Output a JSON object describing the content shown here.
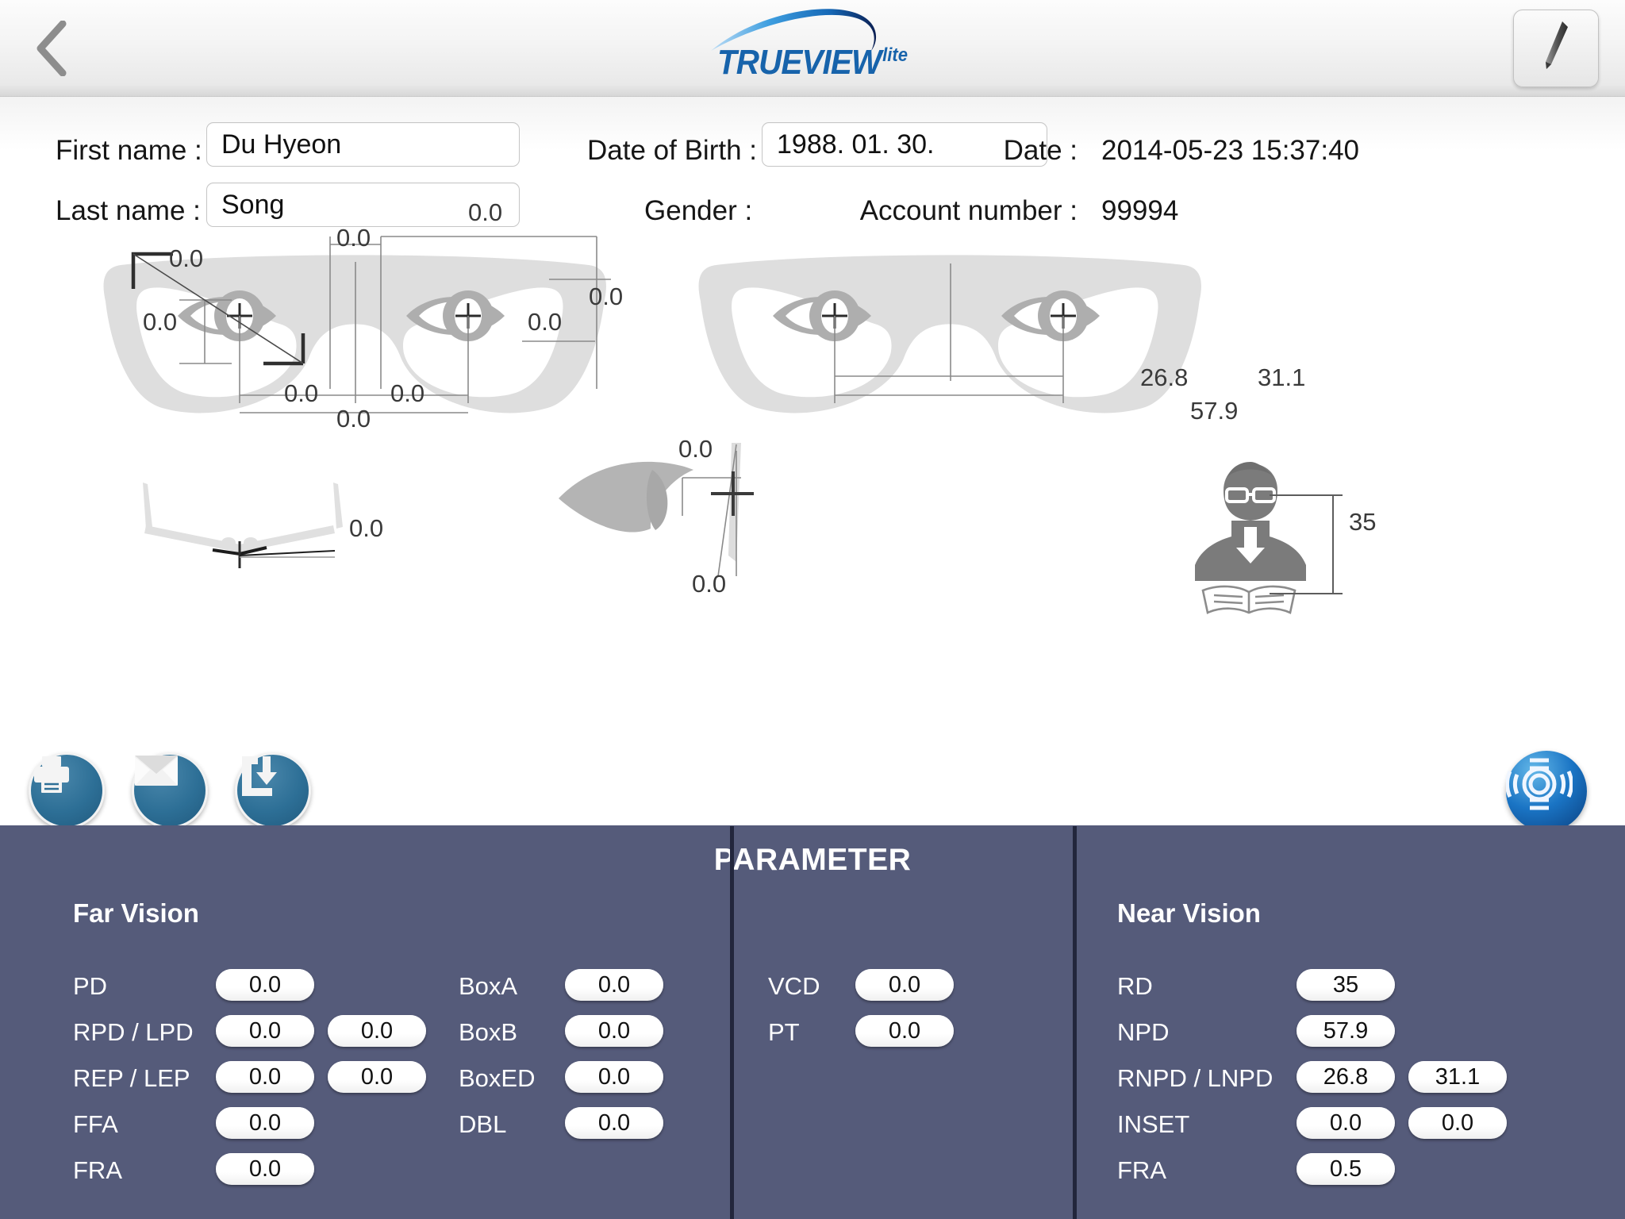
{
  "header": {
    "back_icon": "chevron-left-icon",
    "logo_text": "TRUEVIEW",
    "logo_suffix": "lite",
    "edit_icon": "pencil-icon"
  },
  "patient": {
    "first_name_label": "First name :",
    "first_name_value": "Du Hyeon",
    "last_name_label": "Last name :",
    "last_name_value": "Song",
    "dob_label": "Date of Birth :",
    "dob_value": "1988. 01. 30.",
    "gender_label": "Gender :",
    "gender_male_selected": true,
    "gender_female_selected": false,
    "date_label": "Date :",
    "date_value": "2014-05-23 15:37:40",
    "account_label": "Account number :",
    "account_value": "99994"
  },
  "diagram": {
    "front_left": {
      "dbl_top": "0.0",
      "boxa_top": "0.0",
      "boxed_diag": "0.0",
      "boxb_left": "0.0",
      "boxb_right": "0.0",
      "ffa_right": "0.0",
      "rpd": "0.0",
      "lpd": "0.0",
      "pd_total": "0.0"
    },
    "front_right": {
      "rnpd": "26.8",
      "lnpd": "31.1",
      "npd": "57.9"
    },
    "top_view": {
      "fra": "0.0"
    },
    "side_view": {
      "vcd": "0.0",
      "pt": "0.0"
    },
    "reading": {
      "rd": "35"
    }
  },
  "actions": {
    "print_label": "print-icon",
    "mail_label": "mail-icon",
    "save_label": "save-to-device-icon",
    "scan_label": "scan-target-icon"
  },
  "parameter": {
    "title": "PARAMETER",
    "far_vision_title": "Far Vision",
    "near_vision_title": "Near Vision",
    "far_left": [
      {
        "label": "PD",
        "v1": "0.0",
        "v2": null
      },
      {
        "label": "RPD / LPD",
        "v1": "0.0",
        "v2": "0.0"
      },
      {
        "label": "REP / LEP",
        "v1": "0.0",
        "v2": "0.0"
      },
      {
        "label": "FFA",
        "v1": "0.0",
        "v2": null
      },
      {
        "label": "FRA",
        "v1": "0.0",
        "v2": null
      }
    ],
    "far_mid": [
      {
        "label": "BoxA",
        "v1": "0.0"
      },
      {
        "label": "BoxB",
        "v1": "0.0"
      },
      {
        "label": "BoxED",
        "v1": "0.0"
      },
      {
        "label": "DBL",
        "v1": "0.0"
      }
    ],
    "center_col": [
      {
        "label": "VCD",
        "v1": "0.0"
      },
      {
        "label": "PT",
        "v1": "0.0"
      }
    ],
    "near": [
      {
        "label": "RD",
        "v1": "35",
        "v2": null
      },
      {
        "label": "NPD",
        "v1": "57.9",
        "v2": null
      },
      {
        "label": "RNPD / LNPD",
        "v1": "26.8",
        "v2": "31.1"
      },
      {
        "label": "INSET",
        "v1": "0.0",
        "v2": "0.0"
      },
      {
        "label": "FRA",
        "v1": "0.5",
        "v2": null
      }
    ]
  },
  "colors": {
    "panel_bg": "#555b7a",
    "brand_blue": "#1763ab",
    "button_blue": "#2d6f96",
    "male_blue": "#1f7fe0",
    "female_pink": "#e8327c"
  }
}
